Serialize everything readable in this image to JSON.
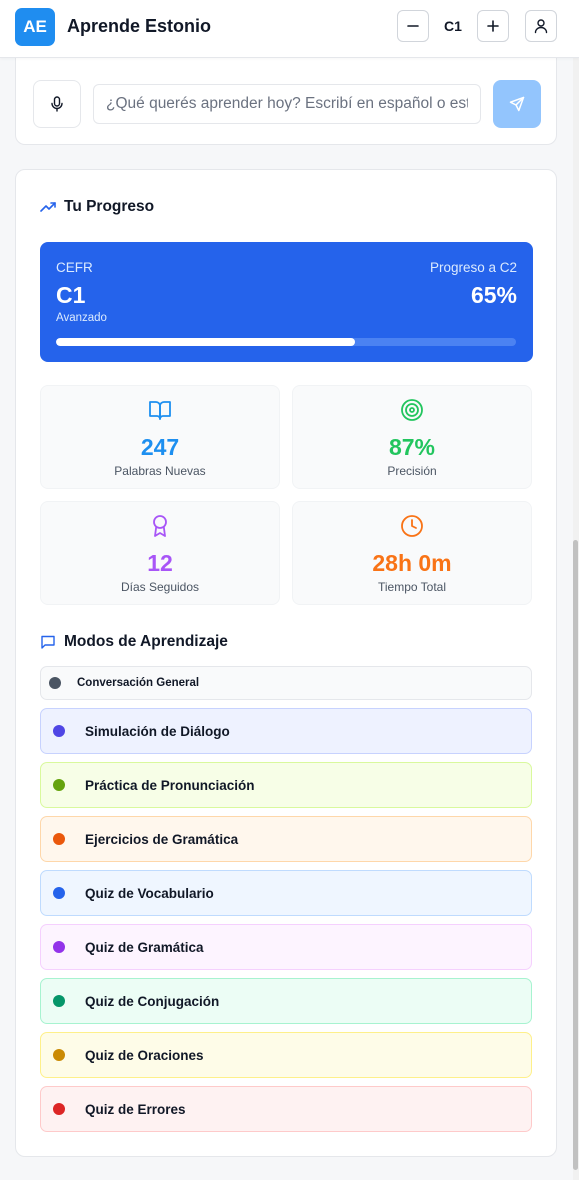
{
  "header": {
    "logo_text": "AE",
    "title": "Aprende Estonio",
    "level": "C1",
    "decrease_icon": "minus-icon",
    "increase_icon": "plus-icon",
    "user_icon": "user-icon"
  },
  "input": {
    "placeholder": "¿Qué querés aprender hoy? Escribí en español o estonio",
    "value": "",
    "mic_icon": "microphone-icon",
    "send_icon": "send-icon"
  },
  "progress": {
    "title": "Tu Progreso",
    "title_icon": "trending-up-icon",
    "cefr_label": "CEFR",
    "level": "C1",
    "level_desc": "Avanzado",
    "target_label": "Progreso a C2",
    "percent_text": "65%",
    "percent_value": 0.65
  },
  "stats": [
    {
      "icon": "book-open-icon",
      "value": "247",
      "label": "Palabras Nuevas",
      "color": "#1d8ff0"
    },
    {
      "icon": "target-icon",
      "value": "87%",
      "label": "Precisión",
      "color": "#22c55e"
    },
    {
      "icon": "award-icon",
      "value": "12",
      "label": "Días Seguidos",
      "color": "#a855f7"
    },
    {
      "icon": "clock-icon",
      "value": "28h 0m",
      "label": "Tiempo Total",
      "color": "#f97316"
    }
  ],
  "modes_section": {
    "title": "Modos de Aprendizaje",
    "title_icon": "message-square-icon"
  },
  "modes": [
    {
      "label": "Conversación General",
      "dot": "#4b5563",
      "bg": "#f9fafb",
      "border": "#e5e7eb"
    },
    {
      "label": "Simulación de Diálogo",
      "dot": "#4f46e5",
      "bg": "#eef2ff",
      "border": "#c7d2fe"
    },
    {
      "label": "Práctica de Pronunciación",
      "dot": "#65a30d",
      "bg": "#f7fee7",
      "border": "#d9f99d"
    },
    {
      "label": "Ejercicios de Gramática",
      "dot": "#ea580c",
      "bg": "#fff7ed",
      "border": "#fed7aa"
    },
    {
      "label": "Quiz de Vocabulario",
      "dot": "#2563eb",
      "bg": "#eff6ff",
      "border": "#bfdbfe"
    },
    {
      "label": "Quiz de Gramática",
      "dot": "#9333ea",
      "bg": "#fdf4ff",
      "border": "#f5d0fe"
    },
    {
      "label": "Quiz de Conjugación",
      "dot": "#059669",
      "bg": "#ecfdf5",
      "border": "#a7f3d0"
    },
    {
      "label": "Quiz de Oraciones",
      "dot": "#ca8a04",
      "bg": "#fefce8",
      "border": "#fef08a"
    },
    {
      "label": "Quiz de Errores",
      "dot": "#dc2626",
      "bg": "#fef2f2",
      "border": "#fecaca"
    }
  ]
}
